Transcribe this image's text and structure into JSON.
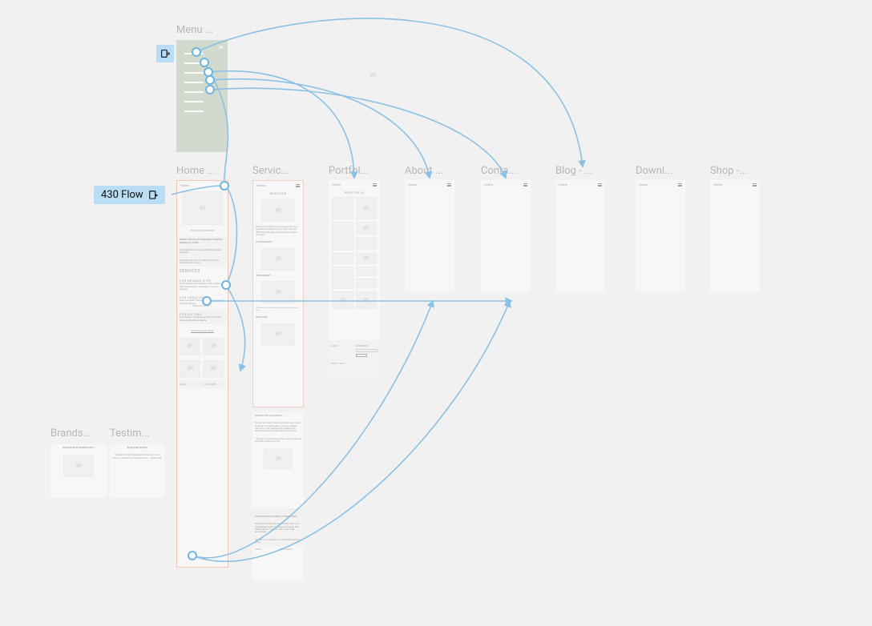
{
  "flow_badge": "430 Flow",
  "menu_label": "Menu ...",
  "pages": [
    {
      "label": "Home ..."
    },
    {
      "label": "Servic..."
    },
    {
      "label": "Portfol..."
    },
    {
      "label": "About ..."
    },
    {
      "label": "Conta..."
    },
    {
      "label": "Blog - ..."
    },
    {
      "label": "Downl..."
    },
    {
      "label": "Shop -..."
    }
  ],
  "components": {
    "brands_label": "Brands...",
    "testimonials_label": "Testim..."
  },
  "home": {
    "hero_tag": "ELEVATE YOUR BRAND",
    "mission_title": "BRAND VISUALS OF YOUR MOST WANTED PRODUCTS—DONE.",
    "mission_body": "We create still & moving content that gets attention.",
    "mission_body2": "Our team will craft a narrative that turns onlookers into buyers.",
    "services_heading": "SERVICES",
    "svc1_title": "FOR BRANDS & PR",
    "svc1_body": "We've worked with brands, so let's create your next showstopper campaign or product imagery.",
    "svc2_title": "FOR CREATIVES",
    "svc2_body": "Need a refresh? Personal branding sessions that feel like you.",
    "svc2_link": "FIND OUT MORE →",
    "svc3_title": "FOR GIFTING",
    "svc3_body": "Commission a bespoke portrait or printed artwork that lasts a lifetime.",
    "instagram": "FOLLOW ALONG ON IG",
    "footer_col1": "LINKS",
    "footer_col2": "SUBSCRIBE"
  },
  "services": {
    "heading": "SERVICES",
    "intro": "Below you'll find pricing, but every shoot is quoted individually so your final cost may differ. Browse approaches below or reach out direct.",
    "p1": "PHOTOGRAPHY",
    "p2": "VIDEOGRAPHY",
    "p3": "DIRECTION",
    "why_title": "SO WHAT SETS US APART?",
    "why_body": "Being a duo team means we share crew costs & deliver combined stills + motion cheaper than most. Our background in agency art direction keeps concepts tight & on-brand.",
    "note": "* Pricing is a guide only and accurate quotes are sent after a discovery call.",
    "pricing_title": "PRICE RANGES OF SKILLS, CAPABILITIES",
    "pricing_body": "Standard full-day stills starts at £1,000. If our deliverables span a multi-day campaign with HMUA, assoc. crews & post, costs scale accordingly.",
    "pricing_body2": "Our aim: you always know where the spend is going.",
    "footer_col1": "LINKS",
    "footer_col2": "SUBSCRIBE"
  },
  "portfolio": {
    "heading": "PORTFOLIO",
    "footer_col1": "LINKS",
    "footer_col2": "SUBSCRIBE",
    "extra": "PREV / NEXT"
  },
  "brands": {
    "heading": "BRANDS WE'VE WORKED WITH"
  },
  "testi": {
    "heading": "SOME KIND WORDS",
    "body": "The team brought exceptional direction to our shoot — couldn't recommend more. — Studio Mgr"
  }
}
